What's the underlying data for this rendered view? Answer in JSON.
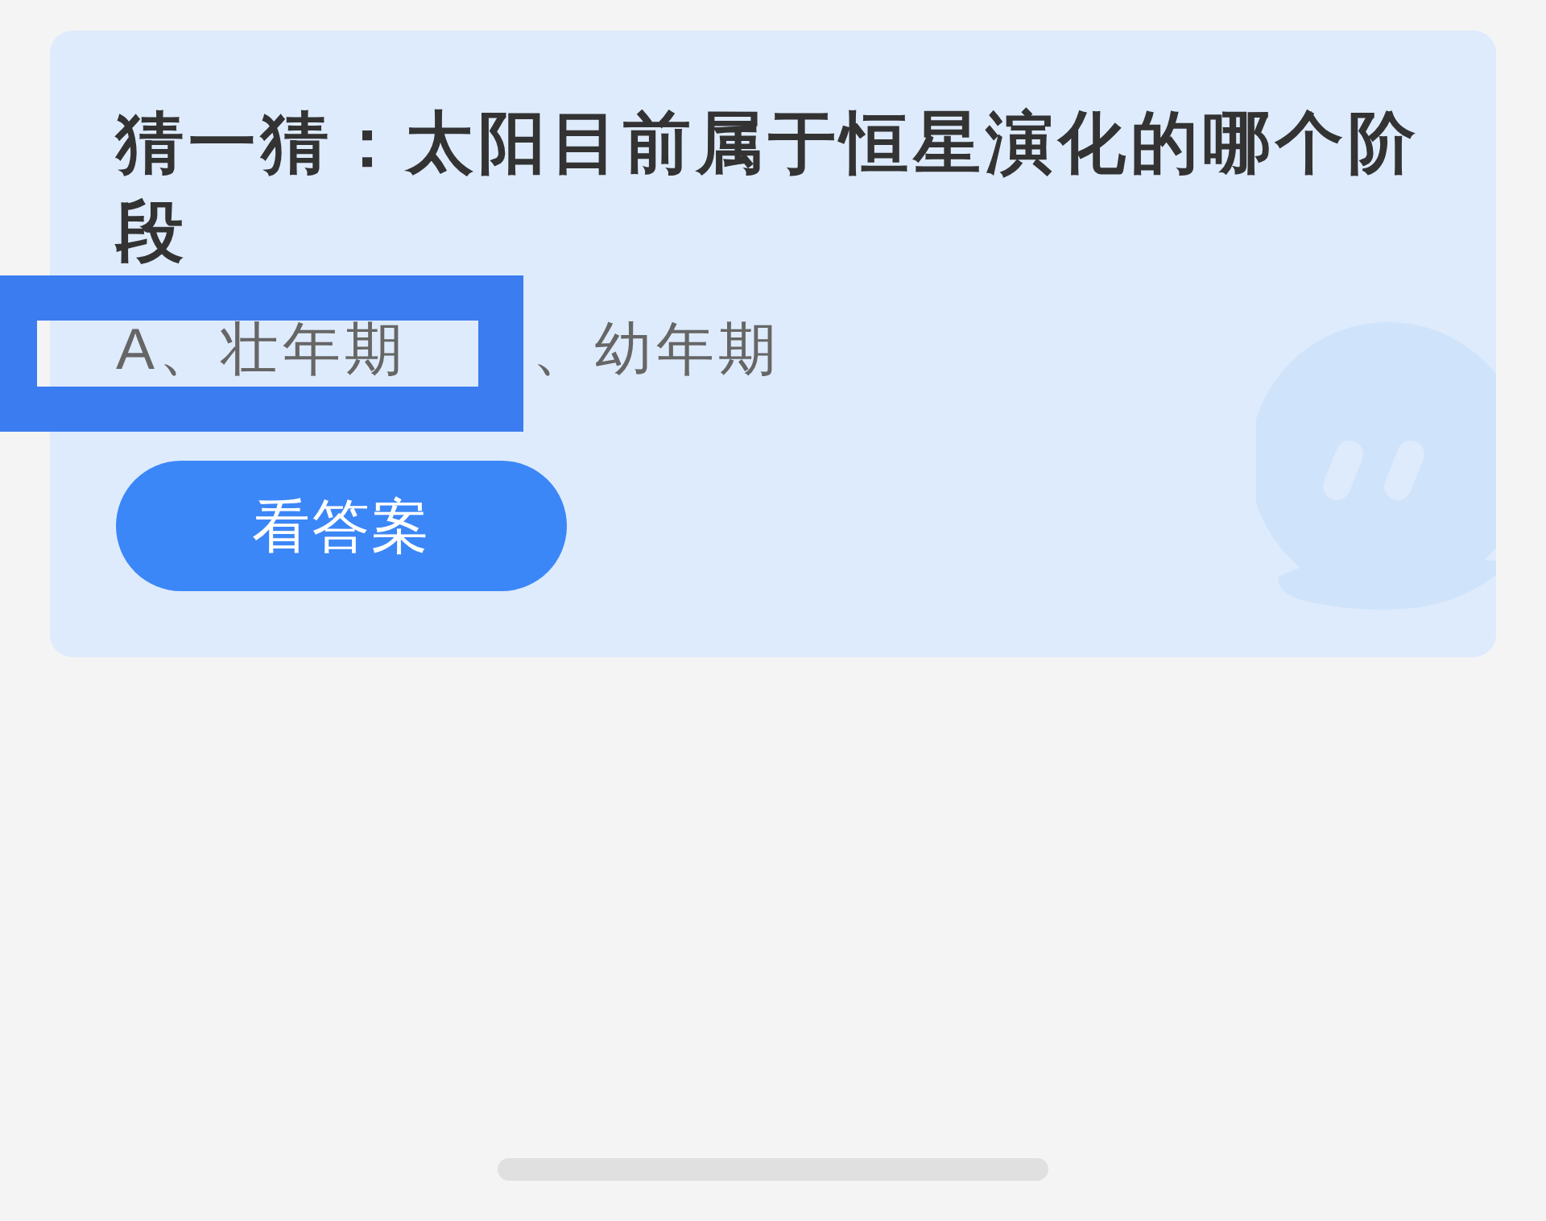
{
  "question": {
    "title": "猜一猜：太阳目前属于恒星演化的哪个阶段",
    "options": [
      {
        "label": "A、壮年期",
        "highlighted": true
      },
      {
        "label": "、幼年期",
        "highlighted": false
      }
    ],
    "button": "看答案"
  }
}
